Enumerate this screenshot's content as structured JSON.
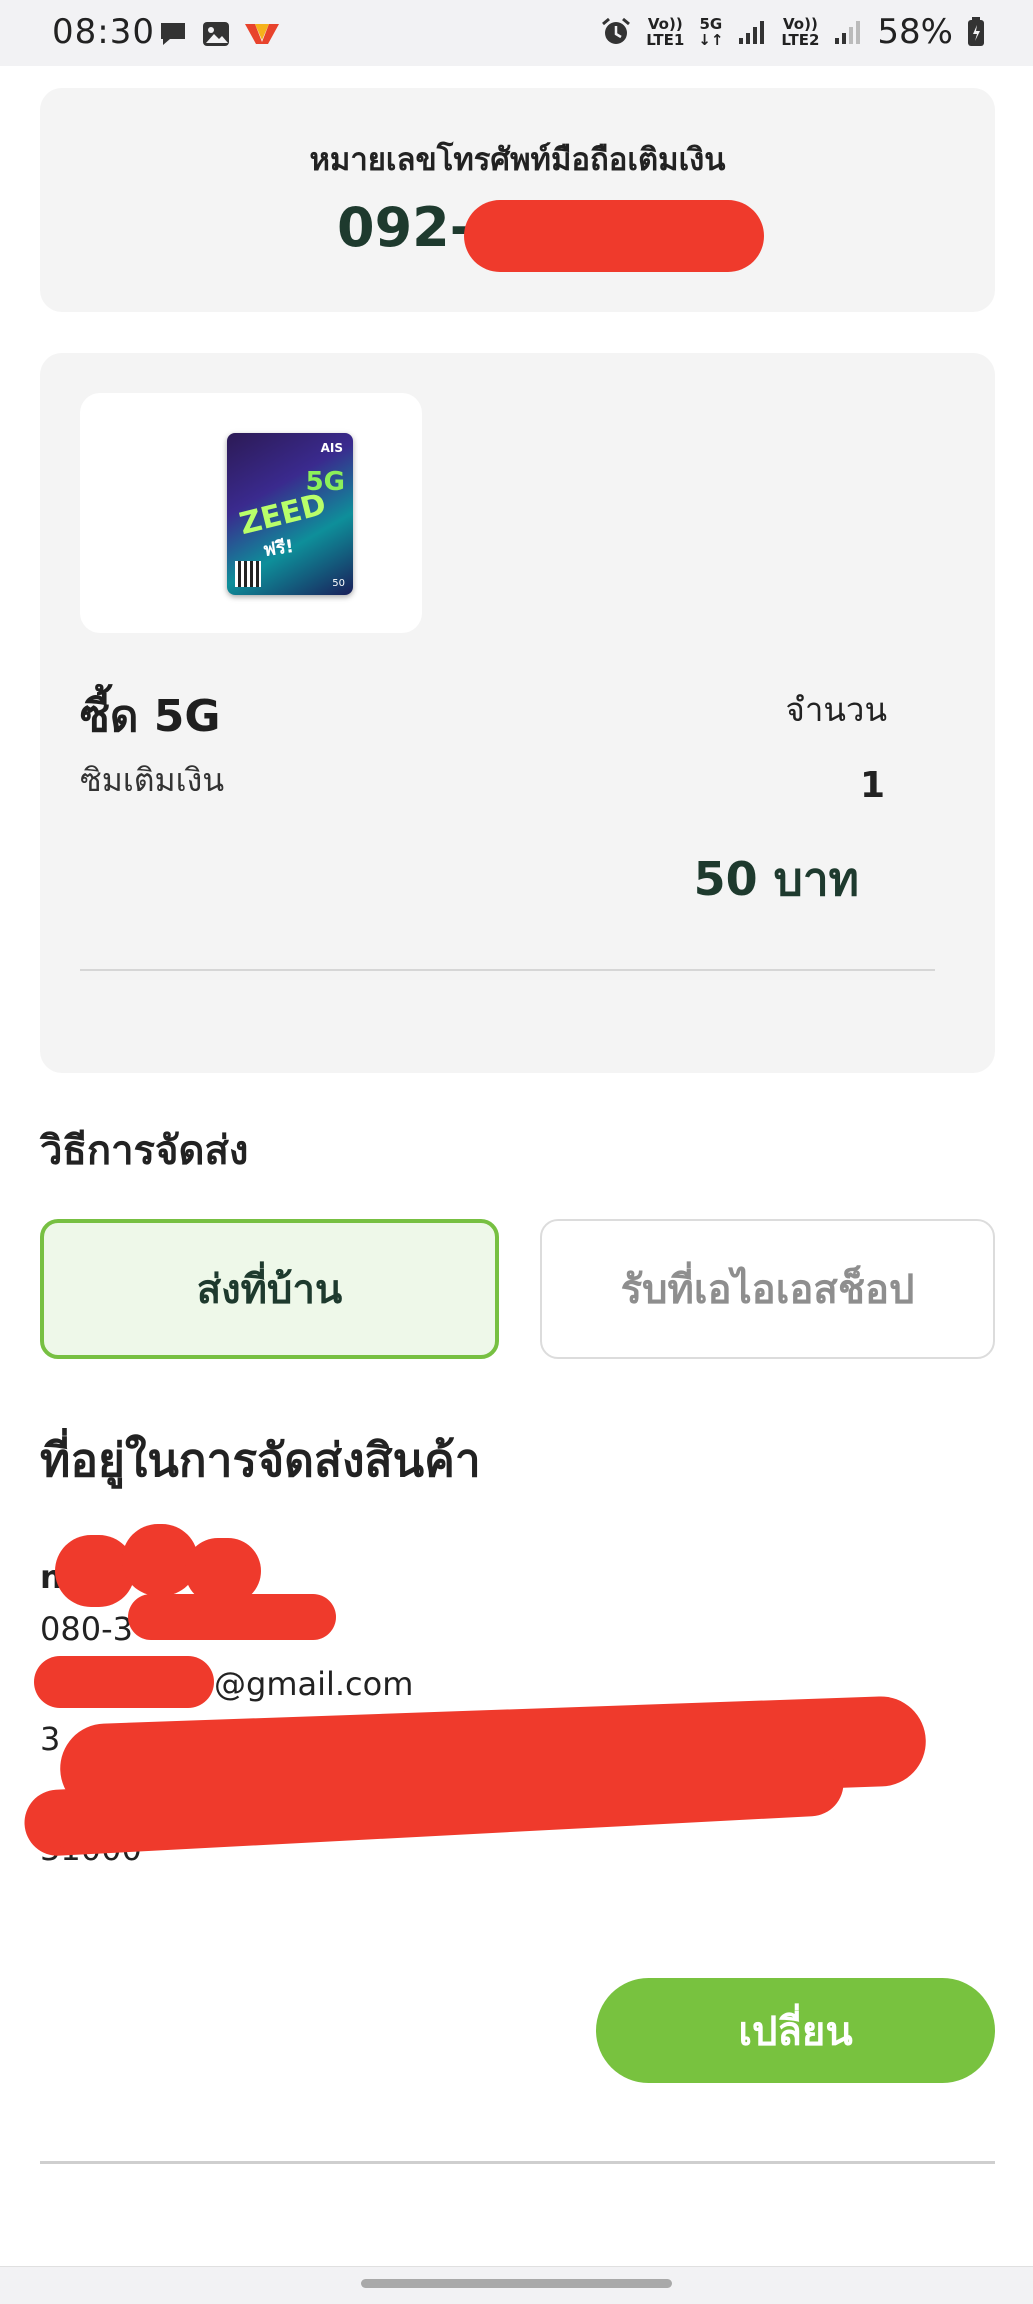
{
  "status_bar": {
    "time": "08:30",
    "battery": "58%",
    "sim1_label": "Vo))\nLTE1",
    "net_label": "5G",
    "sim2_label": "Vo))\nLTE2",
    "icons": [
      "chat-icon",
      "gallery-icon",
      "app-icon",
      "alarm-icon",
      "signal-icon",
      "battery-icon"
    ]
  },
  "phone_card": {
    "label": "หมายเลขโทรศัพท์มือถือเติมเงิน",
    "number_visible": "092-4"
  },
  "product": {
    "sim_brand": "AIS",
    "sim_5g": "5G",
    "sim_title": "ZEED",
    "sim_promo": "ฟรี!",
    "sim_value": "50",
    "name": "ซี้ด 5G",
    "type": "ซิมเติมเงิน",
    "qty_label": "จำนวน",
    "qty_value": "1",
    "price": "50 บาท"
  },
  "delivery": {
    "title": "วิธีการจัดส่ง",
    "options": [
      {
        "label": "ส่งที่บ้าน",
        "selected": true
      },
      {
        "label": "รับที่เอไอเอสช็อป",
        "selected": false
      }
    ]
  },
  "address": {
    "title": "ที่อยู่ในการจัดส่งสินค้า",
    "name_visible": "n",
    "phone_visible": "080-3",
    "email_visible": "@gmail.com",
    "line1_visible": "3",
    "line2_visible": "31000"
  },
  "actions": {
    "change_label": "เปลี่ยน"
  },
  "colors": {
    "accent_green": "#78c23f",
    "dark_green": "#1e3a2e",
    "card_bg": "#f4f4f4",
    "redaction": "#ef3a2c"
  }
}
